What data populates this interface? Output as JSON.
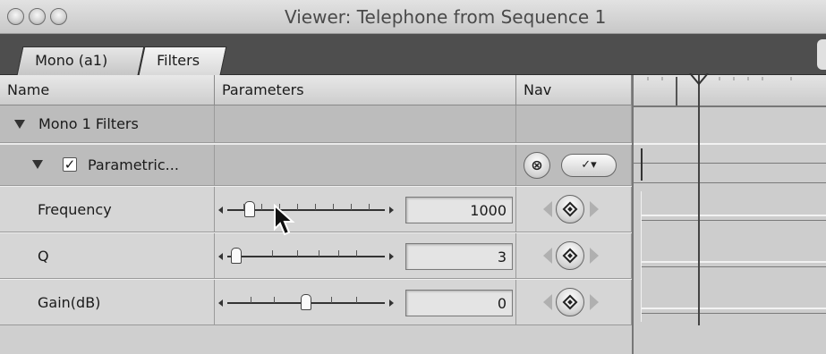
{
  "window": {
    "title": "Viewer: Telephone from Sequence 1"
  },
  "tabs": [
    {
      "label": "Mono (a1)"
    },
    {
      "label": "Filters",
      "active": true
    }
  ],
  "columns": {
    "name": "Name",
    "parameters": "Parameters",
    "nav": "Nav"
  },
  "groups": [
    {
      "label": "Mono 1 Filters"
    },
    {
      "label": "Parametric...",
      "enabled": true,
      "reset_symbol": "⊗",
      "menu_symbol": "✓▾"
    }
  ],
  "params": [
    {
      "name": "Frequency",
      "value": "1000",
      "slider_fraction": 0.15
    },
    {
      "name": "Q",
      "value": "3",
      "slider_fraction": 0.08
    },
    {
      "name": "Gain(dB)",
      "value": "0",
      "slider_fraction": 0.5
    }
  ],
  "icons": {
    "window_buttons": [
      "close-icon",
      "minimize-icon",
      "zoom-icon"
    ],
    "disclosure": "disclosure-triangle-icon",
    "keyframe": "keyframe-diamond-icon",
    "reset": "reset-x-icon",
    "cursor": "mouse-pointer-icon"
  }
}
